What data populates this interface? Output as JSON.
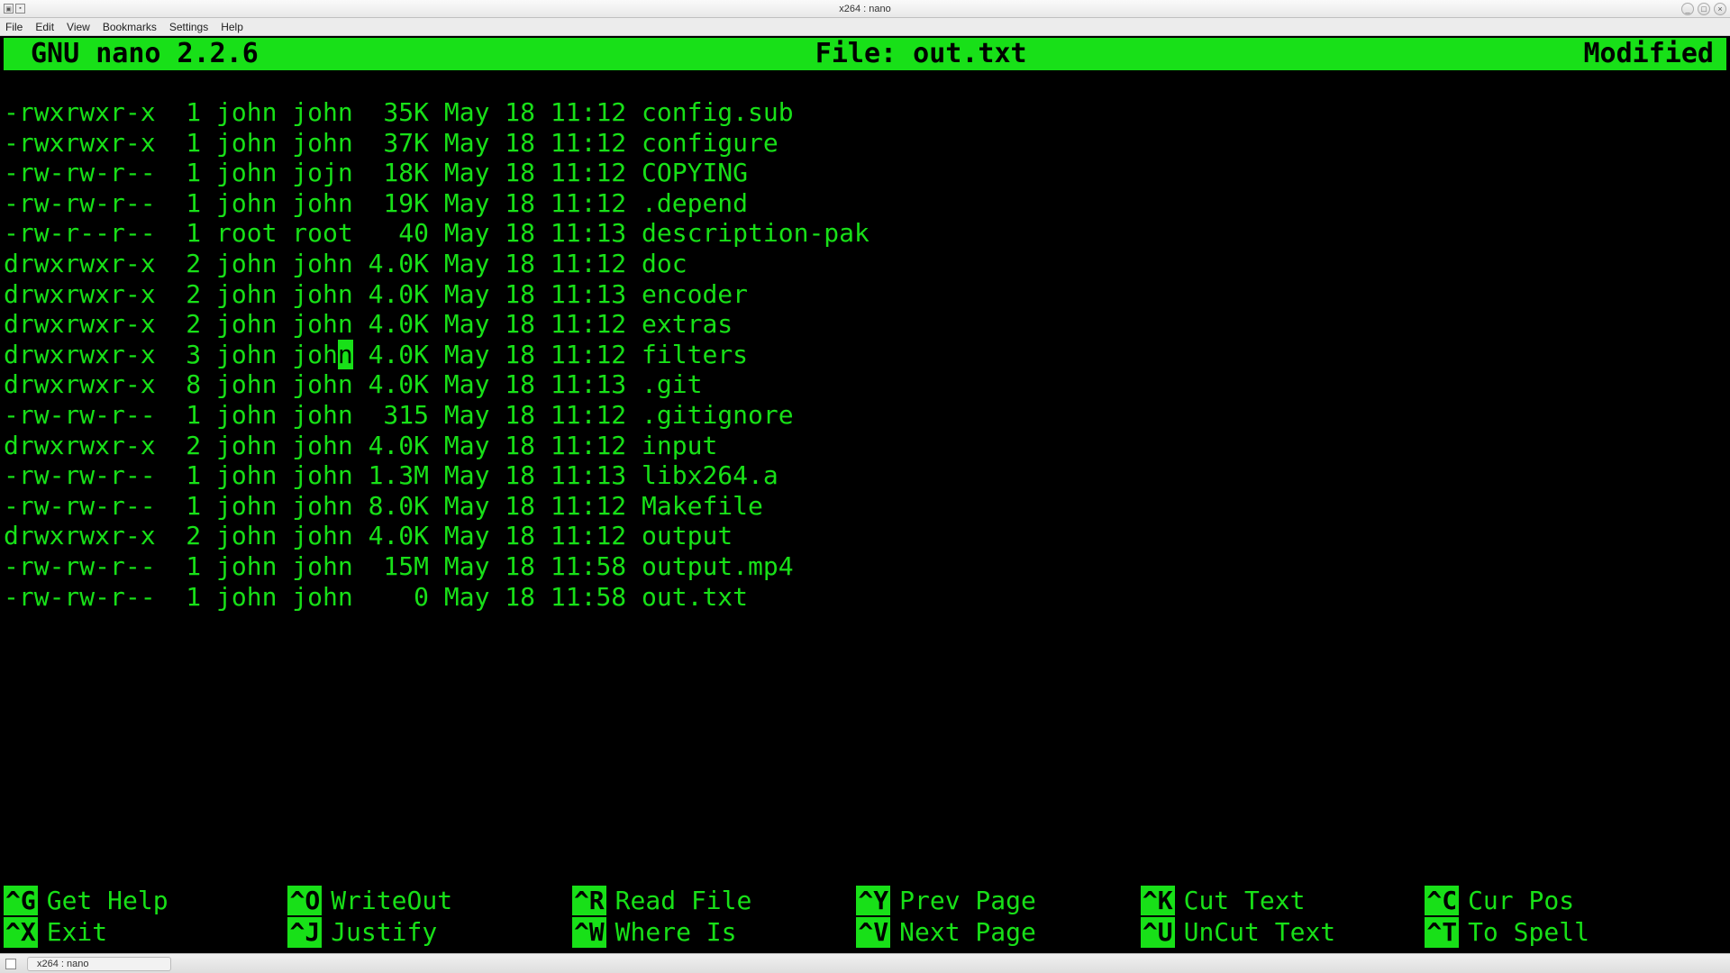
{
  "window": {
    "title": "x264 : nano",
    "control_min": "_",
    "control_max": "□",
    "control_close": "×"
  },
  "menubar": [
    "File",
    "Edit",
    "View",
    "Bookmarks",
    "Settings",
    "Help"
  ],
  "nano": {
    "app_title": "GNU nano 2.2.6",
    "file_label": "File: out.txt",
    "modified": "Modified"
  },
  "cursor": {
    "row": 8,
    "prefix": "drwxrwxr-x  3 john joh",
    "char": "n",
    "suffix": " 4.0K May 18 11:12 filters"
  },
  "lines": [
    "-rwxrwxr-x  1 john john  35K May 18 11:12 config.sub",
    "-rwxrwxr-x  1 john john  37K May 18 11:12 configure",
    "-rw-rw-r--  1 john jojn  18K May 18 11:12 COPYING",
    "-rw-rw-r--  1 john john  19K May 18 11:12 .depend",
    "-rw-r--r--  1 root root   40 May 18 11:13 description-pak",
    "drwxrwxr-x  2 john john 4.0K May 18 11:12 doc",
    "drwxrwxr-x  2 john john 4.0K May 18 11:13 encoder",
    "drwxrwxr-x  2 john john 4.0K May 18 11:12 extras",
    "",
    "drwxrwxr-x  8 john john 4.0K May 18 11:13 .git",
    "-rw-rw-r--  1 john john  315 May 18 11:12 .gitignore",
    "drwxrwxr-x  2 john john 4.0K May 18 11:12 input",
    "-rw-rw-r--  1 john john 1.3M May 18 11:13 libx264.a",
    "-rw-rw-r--  1 john john 8.0K May 18 11:12 Makefile",
    "drwxrwxr-x  2 john john 4.0K May 18 11:12 output",
    "-rw-rw-r--  1 john john  15M May 18 11:58 output.mp4",
    "-rw-rw-r--  1 john john    0 May 18 11:58 out.txt"
  ],
  "shortcuts": [
    {
      "key": "^G",
      "label": "Get Help"
    },
    {
      "key": "^X",
      "label": "Exit"
    },
    {
      "key": "^O",
      "label": "WriteOut"
    },
    {
      "key": "^J",
      "label": "Justify"
    },
    {
      "key": "^R",
      "label": "Read File"
    },
    {
      "key": "^W",
      "label": "Where Is"
    },
    {
      "key": "^Y",
      "label": "Prev Page"
    },
    {
      "key": "^V",
      "label": "Next Page"
    },
    {
      "key": "^K",
      "label": "Cut Text"
    },
    {
      "key": "^U",
      "label": "UnCut Text"
    },
    {
      "key": "^C",
      "label": "Cur Pos"
    },
    {
      "key": "^T",
      "label": "To Spell"
    }
  ],
  "bottom_panel": {
    "task": "x264 : nano"
  }
}
